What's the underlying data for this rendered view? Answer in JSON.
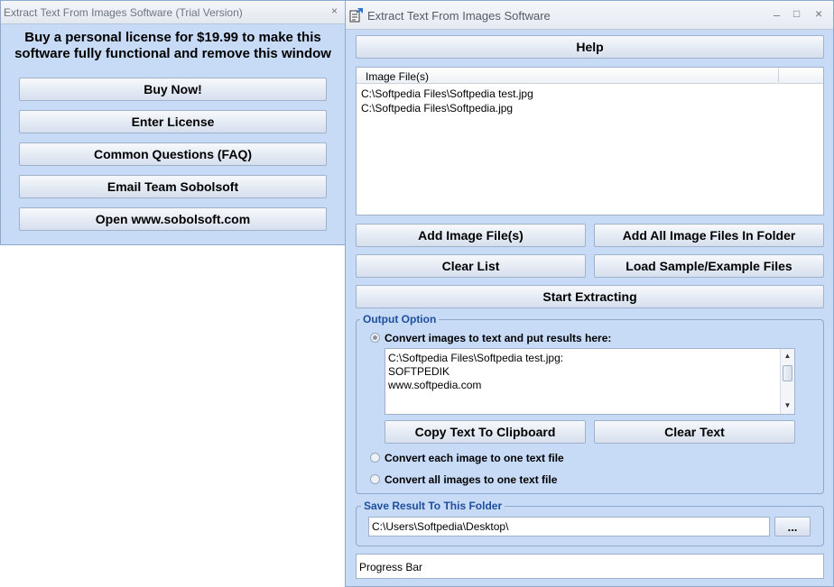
{
  "trial_window": {
    "title": "Extract Text From Images Software (Trial Version)",
    "message_line1": "Buy a personal license for $19.99 to make this",
    "message_line2": "software fully functional and remove this window",
    "buttons": {
      "buy_now": "Buy Now!",
      "enter_license": "Enter License",
      "faq": "Common Questions (FAQ)",
      "email": "Email Team Sobolsoft",
      "website": "Open www.sobolsoft.com"
    }
  },
  "main_window": {
    "title": "Extract Text From Images Software",
    "help_label": "Help",
    "file_list": {
      "column_header": "Image File(s)",
      "items": [
        "C:\\Softpedia Files\\Softpedia test.jpg",
        "C:\\Softpedia Files\\Softpedia.jpg"
      ]
    },
    "buttons": {
      "add_image_files": "Add Image File(s)",
      "add_all_in_folder": "Add All Image Files In Folder",
      "clear_list": "Clear List",
      "load_sample": "Load Sample/Example Files",
      "start_extracting": "Start Extracting",
      "copy_to_clipboard": "Copy Text To Clipboard",
      "clear_text": "Clear Text",
      "browse": "..."
    },
    "output_option": {
      "label": "Output Option",
      "radio_results_here": "Convert images to text and put results here:",
      "radio_each_image": "Convert each image to one text file",
      "radio_all_images": "Convert all images to one text file",
      "results_lines": [
        "C:\\Softpedia Files\\Softpedia test.jpg:",
        "SOFTPEDIK",
        "www.softpedia.com"
      ]
    },
    "save_folder": {
      "label": "Save Result To This Folder",
      "path": "C:\\Users\\Softpedia\\Desktop\\"
    },
    "progress_label": "Progress Bar"
  },
  "icons": {
    "close": "×",
    "minimize": "–",
    "maximize": "□",
    "scroll_up": "▲",
    "scroll_down": "▼"
  },
  "colors": {
    "window_background": "#c7dbf7",
    "group_label": "#1e4e9c"
  }
}
